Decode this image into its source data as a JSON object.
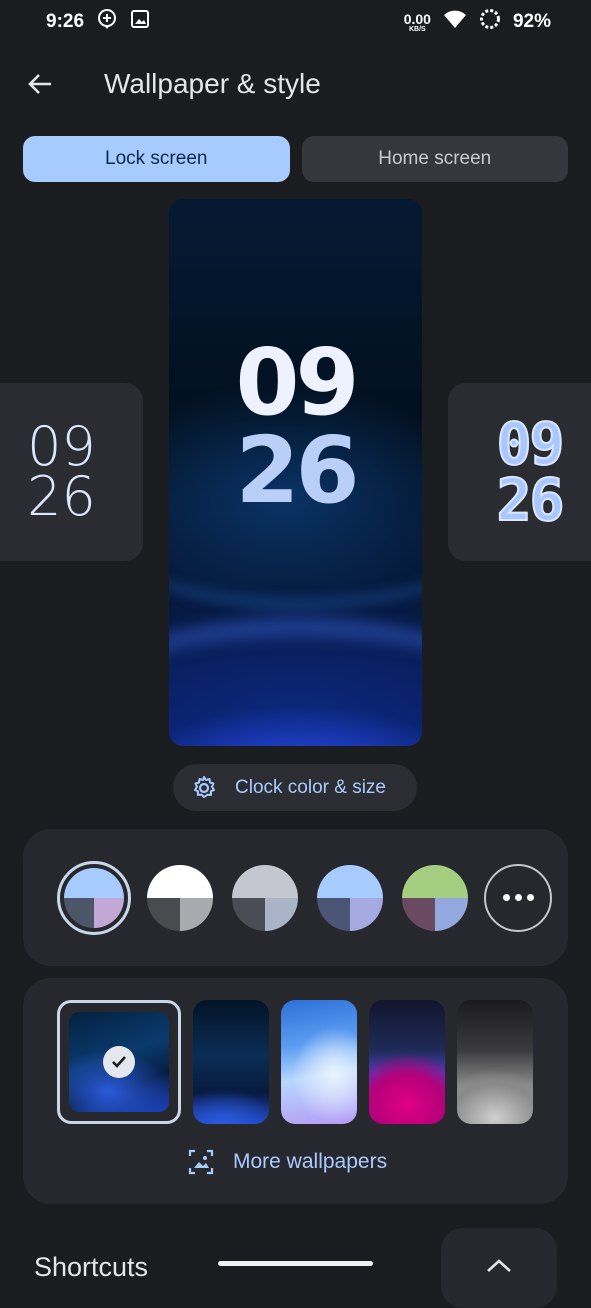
{
  "status_bar": {
    "time": "9:26",
    "net_speed_value": "0.00",
    "net_speed_unit": "KB/S",
    "battery": "92%",
    "icons": [
      "location-plus-icon",
      "image-icon",
      "wifi-icon",
      "battery-ring-icon"
    ]
  },
  "app_bar": {
    "title": "Wallpaper & style",
    "back_icon": "arrow-left-icon"
  },
  "tabs": [
    {
      "label": "Lock screen",
      "active": true
    },
    {
      "label": "Home screen",
      "active": false
    }
  ],
  "preview": {
    "clock_hour": "09",
    "clock_minute": "26",
    "left_clock_hour": "09",
    "left_clock_minute": "26",
    "right_clock_hour": "09",
    "right_clock_minute": "26"
  },
  "clock_button": {
    "label": "Clock color & size",
    "icon": "gear-icon"
  },
  "color_options": [
    {
      "top": "#a8cbff",
      "bottom_left": "#4d5569",
      "bottom_right": "#c2a8d6",
      "selected": true
    },
    {
      "top": "#ffffff",
      "bottom_left": "#4a4b4f",
      "bottom_right": "#a9aaae",
      "selected": false
    },
    {
      "top": "#c4c7d0",
      "bottom_left": "#4a4d55",
      "bottom_right": "#a9b4c6",
      "selected": false
    },
    {
      "top": "#a8cbff",
      "bottom_left": "#4b5576",
      "bottom_right": "#a7aae0",
      "selected": false
    },
    {
      "top": "#a4cf80",
      "bottom_left": "#6a4963",
      "bottom_right": "#93a8de",
      "selected": false
    }
  ],
  "wallpapers": {
    "items": [
      "wallpaper-1",
      "wallpaper-2",
      "wallpaper-3",
      "wallpaper-4",
      "wallpaper-5"
    ],
    "selected_index": 0,
    "more_label": "More wallpapers"
  },
  "sections": {
    "shortcuts_title": "Shortcuts"
  }
}
